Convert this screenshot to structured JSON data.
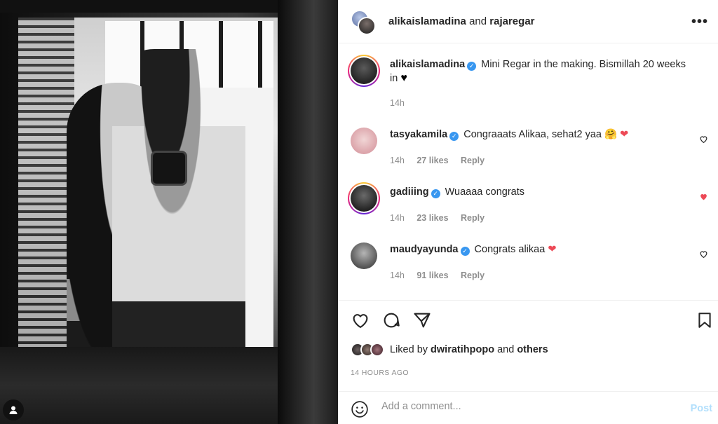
{
  "header": {
    "user1": "alikaislamadina",
    "joiner": "and",
    "user2": "rajaregar",
    "more_icon": "more-horizontal-icon"
  },
  "caption": {
    "username": "alikaislamadina",
    "text": "Mini Regar in the making. Bismillah 20 weeks in",
    "emoji": "♥",
    "time": "14h"
  },
  "comments": [
    {
      "username": "tasyakamila",
      "text": "Congraaats Alikaa, sehat2 yaa",
      "emoji": "🤗 ❤",
      "time": "14h",
      "likes": "27 likes",
      "reply": "Reply",
      "liked": false
    },
    {
      "username": "gadiiing",
      "text": "Wuaaaa congrats",
      "emoji": "",
      "time": "14h",
      "likes": "23 likes",
      "reply": "Reply",
      "liked": true
    },
    {
      "username": "maudyayunda",
      "text": "Congrats alikaa",
      "emoji": "❤",
      "time": "14h",
      "likes": "91 likes",
      "reply": "Reply",
      "liked": false
    }
  ],
  "liked_by": {
    "prefix": "Liked by",
    "user": "dwiratihpopo",
    "joiner": "and",
    "others": "others"
  },
  "timestamp": "14 HOURS AGO",
  "add_comment": {
    "placeholder": "Add a comment...",
    "post_label": "Post"
  },
  "colors": {
    "verified": "#3897f0",
    "like_red": "#ed4956",
    "post_disabled": "#b2dffc"
  }
}
